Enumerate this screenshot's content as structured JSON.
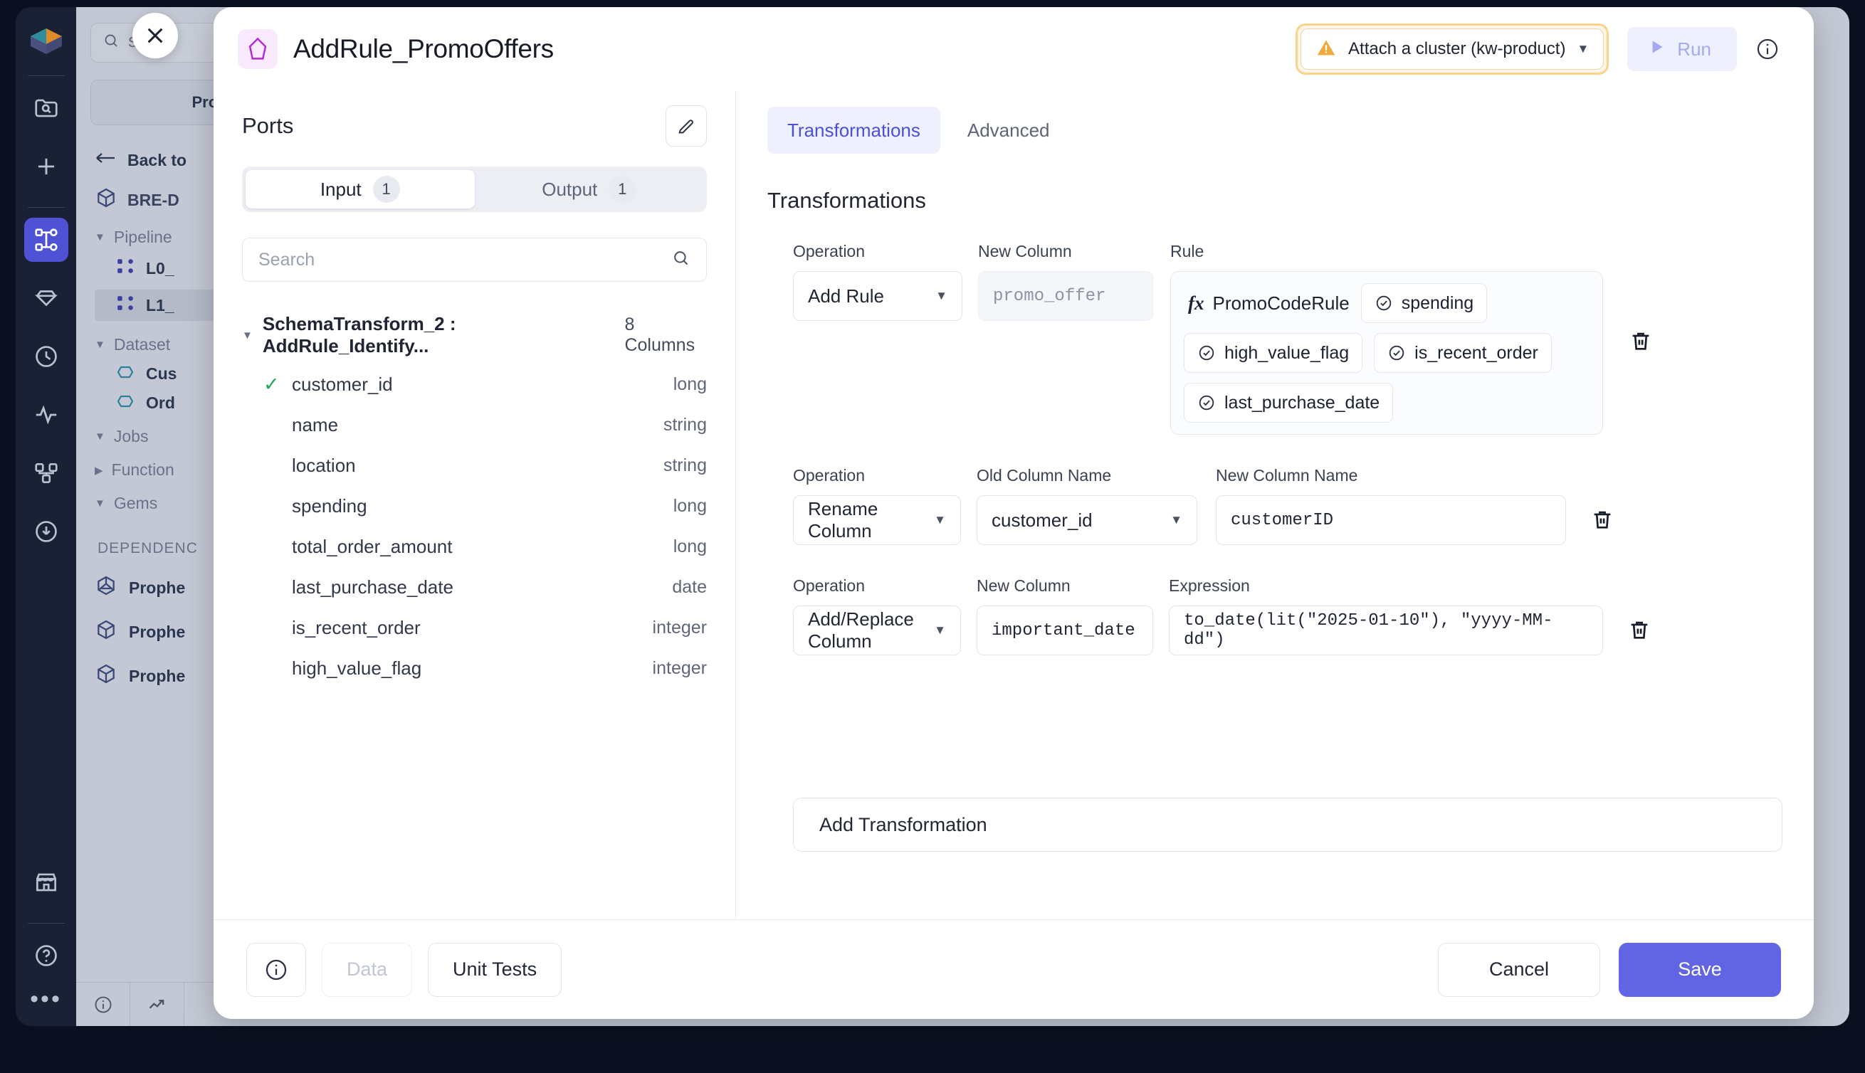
{
  "window": {
    "close_label": "✕"
  },
  "sidebar_rail": {
    "items": [
      {
        "name": "logo",
        "icon": "prophecy-logo"
      },
      {
        "name": "search-project",
        "icon": "folder-search-icon"
      },
      {
        "name": "create-new",
        "icon": "plus-icon"
      },
      {
        "name": "pipelines",
        "icon": "pipeline-graph-icon",
        "active": true
      },
      {
        "name": "gems",
        "icon": "diamond-icon"
      },
      {
        "name": "history",
        "icon": "clock-icon"
      },
      {
        "name": "monitoring",
        "icon": "activity-icon"
      },
      {
        "name": "lineage",
        "icon": "lineage-icon"
      },
      {
        "name": "downloads",
        "icon": "download-circle-icon"
      },
      {
        "name": "marketplace",
        "icon": "storefront-icon"
      },
      {
        "name": "help",
        "icon": "question-circle-icon"
      },
      {
        "name": "more",
        "icon": "ellipsis-icon"
      }
    ]
  },
  "project_tree": {
    "search_placeholder": "Search",
    "project_button": "Proje",
    "back_label": "Back to",
    "root": "BRE-D",
    "groups": [
      {
        "label": "Pipeline",
        "expanded": true
      },
      {
        "label": "Dataset",
        "expanded": true
      },
      {
        "label": "Jobs",
        "expanded": true
      },
      {
        "label": "Function",
        "expanded": false
      },
      {
        "label": "Gems",
        "expanded": true
      }
    ],
    "pipelines": [
      {
        "label": "L0_",
        "selected": false
      },
      {
        "label": "L1_",
        "selected": true
      }
    ],
    "datasets": [
      {
        "label": "Cus"
      },
      {
        "label": "Ord"
      }
    ],
    "dependencies_title": "DEPENDENC",
    "dependencies": [
      {
        "label": "Prophe",
        "icon": "prophecy-package-icon"
      },
      {
        "label": "Prophe",
        "icon": "cube-icon"
      },
      {
        "label": "Prophe",
        "icon": "cube-icon"
      }
    ],
    "footer_icons": [
      "info-circle-icon",
      "trend-arrow-icon"
    ]
  },
  "modal": {
    "title": "AddRule_PromoOffers",
    "gem_icon": "gem-pentagon-icon",
    "cluster": {
      "label": "Attach a cluster (kw-product)",
      "warning_icon": "warning-triangle-icon",
      "caret": "▼"
    },
    "run": {
      "label": "Run",
      "icon": "play-icon",
      "disabled": true
    },
    "info_icon": "info-circle-icon"
  },
  "ports": {
    "title": "Ports",
    "edit_icon": "pencil-icon",
    "tabs": [
      {
        "label": "Input",
        "count": "1",
        "active": true
      },
      {
        "label": "Output",
        "count": "1",
        "active": false
      }
    ],
    "search_placeholder": "Search",
    "search_value": "",
    "search_icon": "search-icon",
    "schema": {
      "name": "SchemaTransform_2 : AddRule_Identify...",
      "columns_label": "8 Columns",
      "expanded": true
    },
    "columns": [
      {
        "name": "customer_id",
        "type": "long",
        "checked": true
      },
      {
        "name": "name",
        "type": "string",
        "checked": false
      },
      {
        "name": "location",
        "type": "string",
        "checked": false
      },
      {
        "name": "spending",
        "type": "long",
        "checked": false
      },
      {
        "name": "total_order_amount",
        "type": "long",
        "checked": false
      },
      {
        "name": "last_purchase_date",
        "type": "date",
        "checked": false
      },
      {
        "name": "is_recent_order",
        "type": "integer",
        "checked": false
      },
      {
        "name": "high_value_flag",
        "type": "integer",
        "checked": false
      }
    ]
  },
  "right_pane": {
    "tabs": [
      {
        "label": "Transformations",
        "active": true
      },
      {
        "label": "Advanced",
        "active": false
      }
    ],
    "section_title": "Transformations",
    "add_transformation_label": "Add Transformation",
    "delete_icon": "trash-icon",
    "rows": [
      {
        "kind": "add_rule",
        "operation_label": "Operation",
        "operation_value": "Add Rule",
        "new_column_label": "New Column",
        "new_column_value": "promo_offer",
        "new_column_muted": true,
        "rule_label": "Rule",
        "rule_fx": "PromoCodeRule",
        "rule_fx_mark": "fx",
        "rule_chips": [
          "spending",
          "high_value_flag",
          "is_recent_order",
          "last_purchase_date"
        ]
      },
      {
        "kind": "rename_column",
        "operation_label": "Operation",
        "operation_value": "Rename Column",
        "old_column_label": "Old Column Name",
        "old_column_value": "customer_id",
        "new_column_label": "New Column Name",
        "new_column_value": "customerID"
      },
      {
        "kind": "add_replace_column",
        "operation_label": "Operation",
        "operation_value": "Add/Replace Column",
        "new_column_label": "New Column",
        "new_column_value": "important_date",
        "expression_label": "Expression",
        "expression_value": "to_date(lit(\"2025-01-10\"), \"yyyy-MM-dd\")"
      }
    ]
  },
  "footer": {
    "info_icon": "info-circle-icon",
    "data_label": "Data",
    "unit_tests_label": "Unit Tests",
    "cancel_label": "Cancel",
    "save_label": "Save"
  },
  "colors": {
    "accent": "#6265e3",
    "tab_active_bg": "#eef0fd",
    "tab_active_text": "#4c50d8",
    "warning_border": "#f7d58a",
    "check_green": "#22a45d",
    "rail_active": "#4f52d4"
  }
}
